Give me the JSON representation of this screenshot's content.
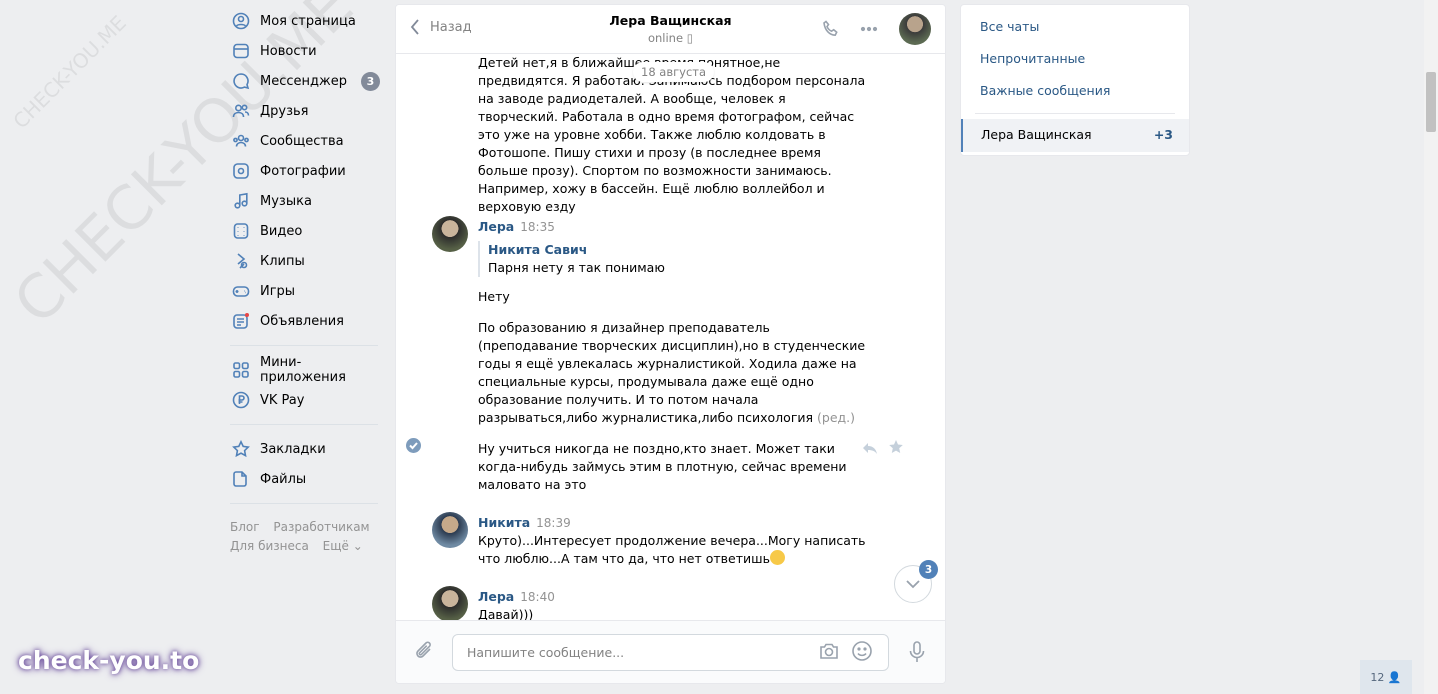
{
  "nav": {
    "items": [
      {
        "label": "Моя страница",
        "icon": "user-circle-icon"
      },
      {
        "label": "Новости",
        "icon": "news-icon"
      },
      {
        "label": "Мессенджер",
        "icon": "message-icon",
        "count": "3"
      },
      {
        "label": "Друзья",
        "icon": "friends-icon"
      },
      {
        "label": "Сообщества",
        "icon": "groups-icon"
      },
      {
        "label": "Фотографии",
        "icon": "photo-icon"
      },
      {
        "label": "Музыка",
        "icon": "music-icon"
      },
      {
        "label": "Видео",
        "icon": "video-icon"
      },
      {
        "label": "Клипы",
        "icon": "clips-icon"
      },
      {
        "label": "Игры",
        "icon": "gamepad-icon"
      },
      {
        "label": "Объявления",
        "icon": "ads-icon"
      }
    ],
    "items2": [
      {
        "label": "Мини-приложения",
        "icon": "apps-icon"
      },
      {
        "label": "VK Pay",
        "icon": "vkpay-icon"
      }
    ],
    "items3": [
      {
        "label": "Закладки",
        "icon": "star-icon"
      },
      {
        "label": "Файлы",
        "icon": "file-icon"
      }
    ],
    "footer": {
      "blog": "Блог",
      "dev": "Разработчикам",
      "business": "Для бизнеса",
      "more": "Ещё ⌄"
    }
  },
  "watermark": {
    "big": "CHECK-YOU.ME",
    "small": "CHECK-YOU.ME",
    "brand": "check-you.to"
  },
  "chat": {
    "back": "Назад",
    "peer_name": "Лера Ващинская",
    "peer_status": "online",
    "date_pill": "18 августа",
    "msg1": "Детей нет,я в ближайшее время,понятное,не предвидятся. Я работаю. Занимаюсь подбором персонала на заводе радиодеталей. А вообще, человек я творческий. Работала в одно время фотографом, сейчас это уже на уровне хобби. Также люблю колдовать в Фотошопе. Пишу стихи и прозу (в последнее время больше прозу). Спортом по возможности занимаюсь. Например, хожу в бассейн. Ещё люблю воллейбол и верховую езду",
    "lera1_author": "Лера",
    "lera1_time": "18:35",
    "quote_author": "Никита Савич",
    "quote_text": "Парня нету я так понимаю",
    "msg2": "Нету",
    "msg3": "По образованию я дизайнер преподаватель (преподавание творческих дисциплин),но в студенческие годы я ещё увлекалась журналистикой. Ходила даже на специальные курсы, продумывала даже ещё одно образование получить. И то потом начала разрываться,либо журналистика,либо психология",
    "edited": "(ред.)",
    "msg4": "Ну учиться никогда не поздно,кто знает. Может таки когда-нибудь займусь этим в плотную, сейчас времени маловато на это",
    "nik_author": "Никита",
    "nik_time": "18:39",
    "msg5": "Круто)...Интересует продолжение вечера...Могу написать что люблю...А там что да, что нет ответишь",
    "lera2_author": "Лера",
    "lera2_time": "18:40",
    "msg6": "Давай)))",
    "unread_count": "3",
    "input_placeholder": "Напишите сообщение..."
  },
  "right": {
    "all": "Все чаты",
    "unread": "Непрочитанные",
    "important": "Важные сообщения",
    "active_name": "Лера Ващинская",
    "active_count": "+3"
  },
  "online_badge": "12",
  "colors": {
    "accent": "#5181b8",
    "link": "#2a5885",
    "bg": "#edeef0"
  }
}
